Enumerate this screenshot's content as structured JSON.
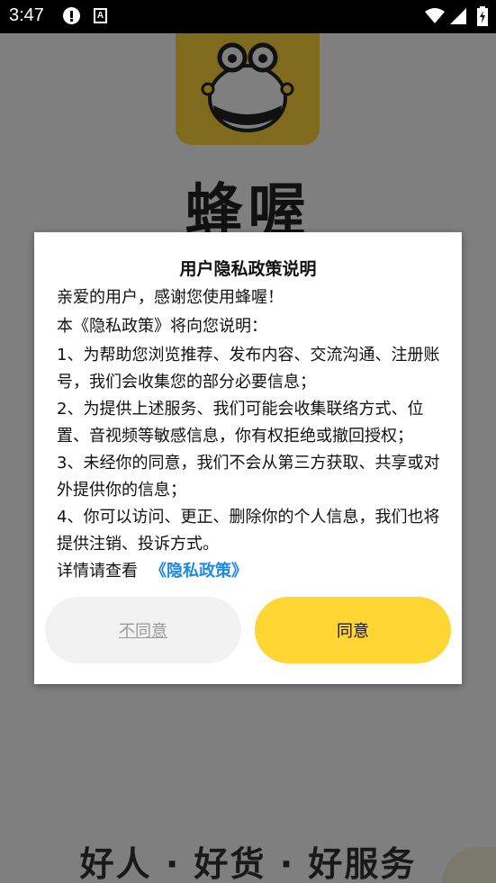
{
  "status_bar": {
    "time": "3:47",
    "keyboard_badge": "A"
  },
  "background": {
    "app_name": "蜂喔",
    "slogan": "好人 · 好货 · 好服务",
    "brand_color": "#ffd43a"
  },
  "dialog": {
    "title": "用户隐私政策说明",
    "paragraphs": [
      "亲爱的用户，感谢您使用蜂喔！",
      "本《隐私政策》将向您说明：",
      "1、为帮助您浏览推荐、发布内容、交流沟通、注册账号，我们会收集您的部分必要信息；",
      "2、为提供上述服务、我们可能会收集联络方式、位置、音视频等敏感信息，你有权拒绝或撤回授权；",
      "3、未经你的同意，我们不会从第三方获取、共享或对外提供你的信息；",
      "4、你可以访问、更正、删除你的个人信息，我们也将提供注销、投诉方式。"
    ],
    "detail_prefix": "详情请查看",
    "policy_link": "《隐私政策》",
    "link_color": "#1e88e5",
    "disagree_label": "不同意",
    "agree_label": "同意",
    "agree_color": "#ffd634"
  }
}
